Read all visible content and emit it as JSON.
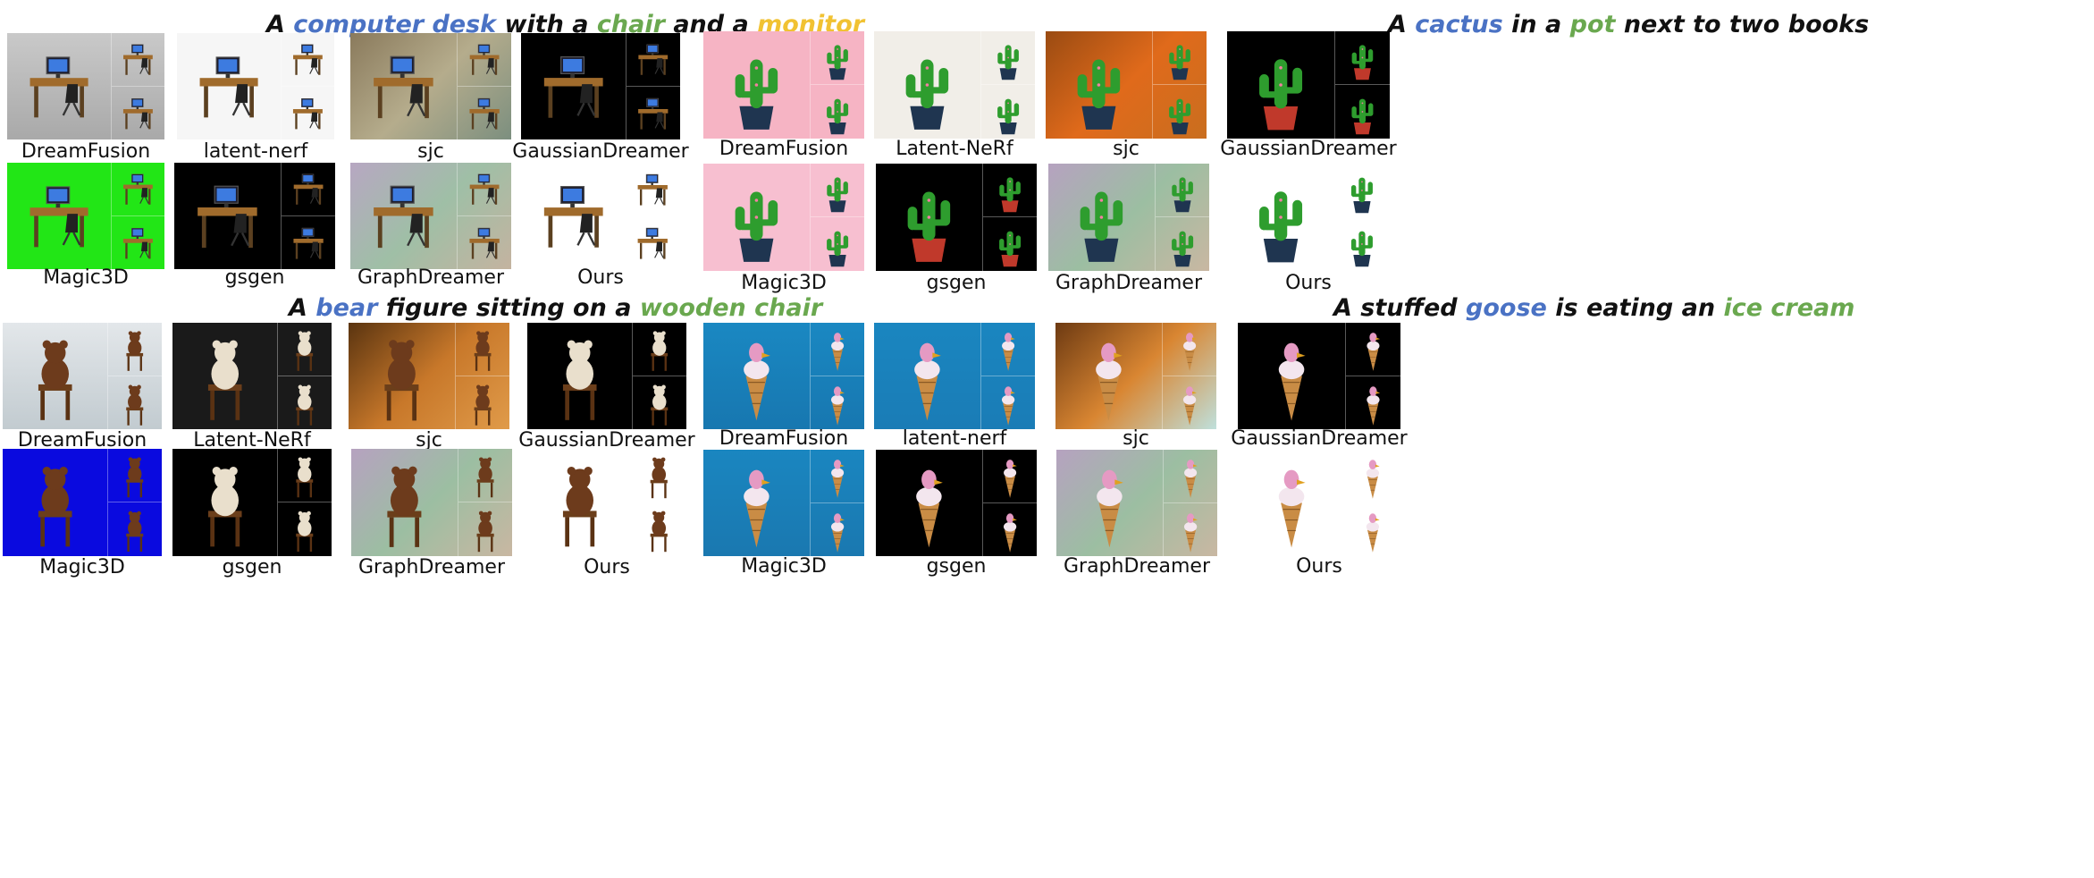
{
  "colors": {
    "blue": "#4a72c4",
    "green": "#6aa84f",
    "yellow": "#f1c232",
    "black": "#111111"
  },
  "panels": [
    {
      "caption": [
        {
          "text": "A ",
          "color": "black"
        },
        {
          "text": "computer desk",
          "color": "blue"
        },
        {
          "text": " with a ",
          "color": "black"
        },
        {
          "text": "chair",
          "color": "green"
        },
        {
          "text": " and a ",
          "color": "black"
        },
        {
          "text": "monitor",
          "color": "yellow"
        }
      ],
      "row1": [
        "DreamFusion",
        "latent-nerf",
        "sjc",
        "GaussianDreamer"
      ],
      "row2": [
        "Magic3D",
        "gsgen",
        "GraphDreamer",
        "Ours"
      ]
    },
    {
      "caption": [
        {
          "text": "A ",
          "color": "black"
        },
        {
          "text": "cactus",
          "color": "blue"
        },
        {
          "text": " in a ",
          "color": "black"
        },
        {
          "text": "pot",
          "color": "green"
        },
        {
          "text": " next to two books",
          "color": "black"
        }
      ],
      "row1": [
        "DreamFusion",
        "Latent-NeRf",
        "sjc",
        "GaussianDreamer"
      ],
      "row2": [
        "Magic3D",
        "gsgen",
        "GraphDreamer",
        "Ours"
      ]
    },
    {
      "caption": [
        {
          "text": "A ",
          "color": "black"
        },
        {
          "text": "bear",
          "color": "blue"
        },
        {
          "text": " figure sitting on a ",
          "color": "black"
        },
        {
          "text": "wooden chair",
          "color": "green"
        }
      ],
      "row1": [
        "DreamFusion",
        "Latent-NeRf",
        "sjc",
        "GaussianDreamer"
      ],
      "row2": [
        "Magic3D",
        "gsgen",
        "GraphDreamer",
        "Ours"
      ]
    },
    {
      "caption": [
        {
          "text": "A stuffed ",
          "color": "black"
        },
        {
          "text": "goose",
          "color": "blue"
        },
        {
          "text": " is eating an ",
          "color": "black"
        },
        {
          "text": "ice cream",
          "color": "green"
        }
      ],
      "row1": [
        "DreamFusion",
        "latent-nerf",
        "sjc",
        "GaussianDreamer"
      ],
      "row2": [
        "Magic3D",
        "gsgen",
        "GraphDreamer",
        "Ours"
      ]
    }
  ]
}
